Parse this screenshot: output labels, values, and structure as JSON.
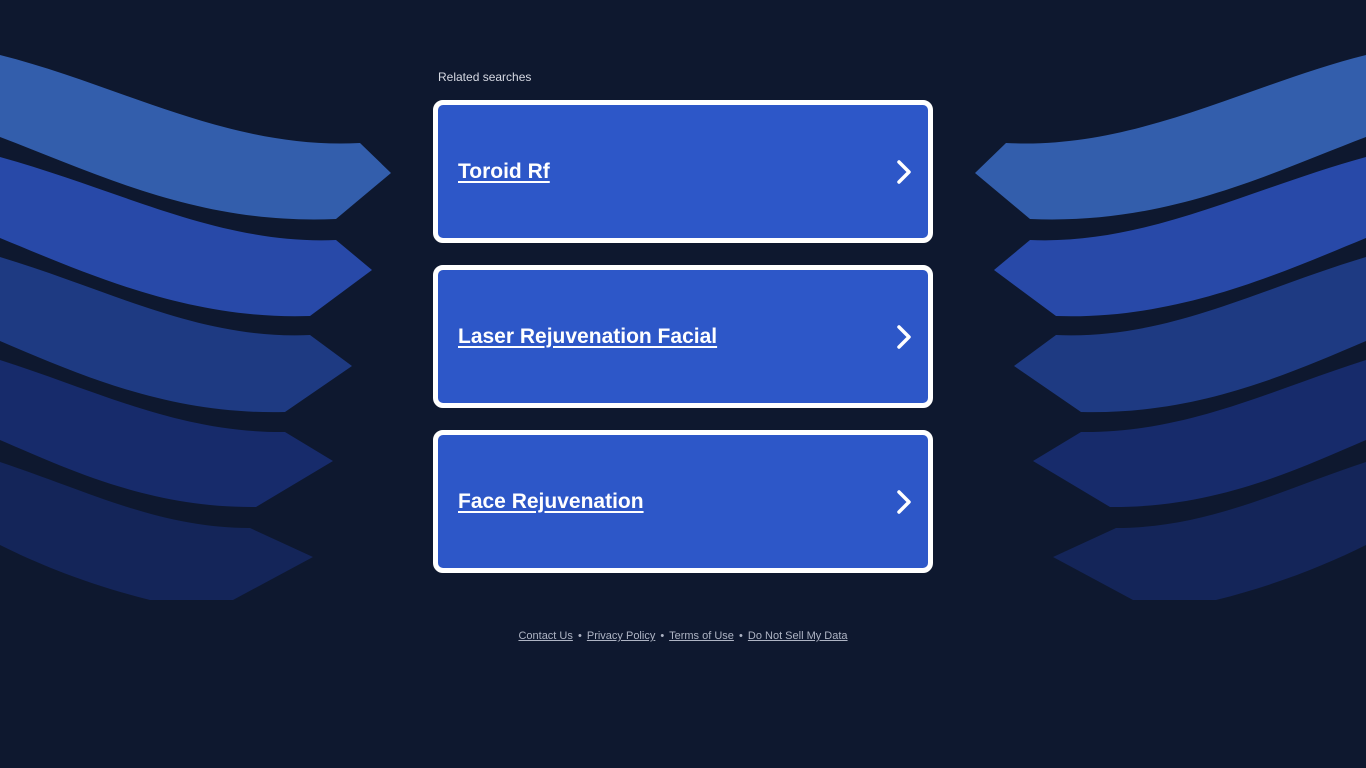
{
  "related_searches": {
    "heading": "Related searches",
    "items": [
      {
        "label": "Toroid Rf"
      },
      {
        "label": "Laser Rejuvenation Facial"
      },
      {
        "label": "Face Rejuvenation"
      }
    ]
  },
  "footer": {
    "links": [
      {
        "label": "Contact Us"
      },
      {
        "label": "Privacy Policy"
      },
      {
        "label": "Terms of Use"
      },
      {
        "label": "Do Not Sell My Data"
      }
    ],
    "separator": "•"
  },
  "icons": {
    "card_chevron": "chevron-right-icon"
  },
  "colors": {
    "page_background": "#0e182f",
    "card_background": "#2d57c8",
    "card_border": "#ffffff",
    "band_colors": [
      "#335eac",
      "#2849a8",
      "#1e3a82",
      "#172b6b",
      "#142559"
    ]
  }
}
